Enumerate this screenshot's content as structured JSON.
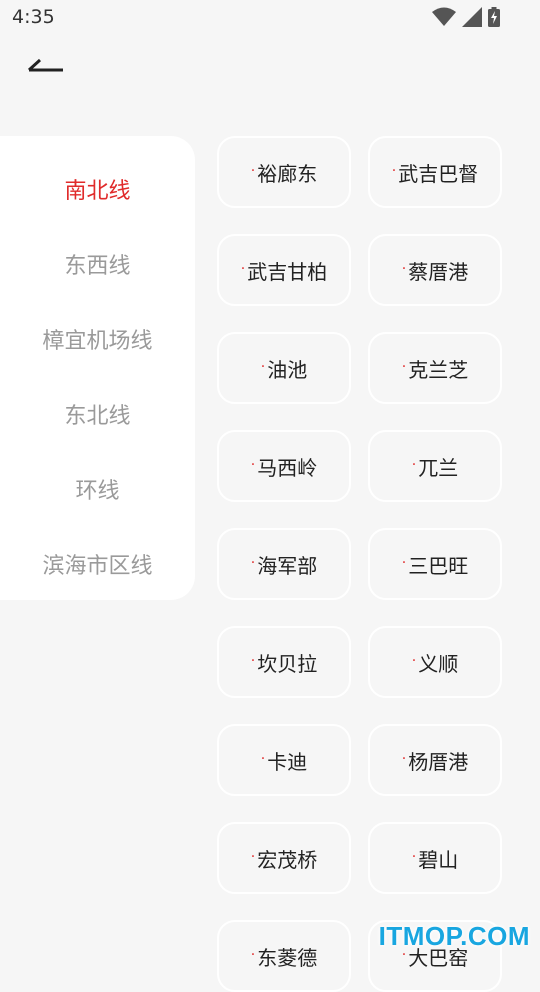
{
  "status_bar": {
    "time": "4:35",
    "icons": [
      "wifi-icon",
      "cell-signal-icon",
      "battery-charging-icon"
    ]
  },
  "header": {
    "back_icon": "back-arrow-icon"
  },
  "sidebar": {
    "items": [
      {
        "label": "南北线",
        "active": true
      },
      {
        "label": "东西线",
        "active": false
      },
      {
        "label": "樟宜机场线",
        "active": false
      },
      {
        "label": "东北线",
        "active": false
      },
      {
        "label": "环线",
        "active": false
      },
      {
        "label": "滨海市区线",
        "active": false
      }
    ]
  },
  "stations": {
    "dot_glyph": "·",
    "items": [
      "裕廊东",
      "武吉巴督",
      "武吉甘柏",
      "蔡厝港",
      "油池",
      "克兰芝",
      "马西岭",
      "兀兰",
      "海军部",
      "三巴旺",
      "坎贝拉",
      "义顺",
      "卡迪",
      "杨厝港",
      "宏茂桥",
      "碧山",
      "东菱德",
      "大巴窑"
    ]
  },
  "watermark": {
    "text": "ITMOP.COM"
  },
  "colors": {
    "accent": "#e02b2b",
    "inactive_text": "#9a9a9a",
    "background": "#f6f6f6",
    "watermark": "#18a6e0"
  }
}
